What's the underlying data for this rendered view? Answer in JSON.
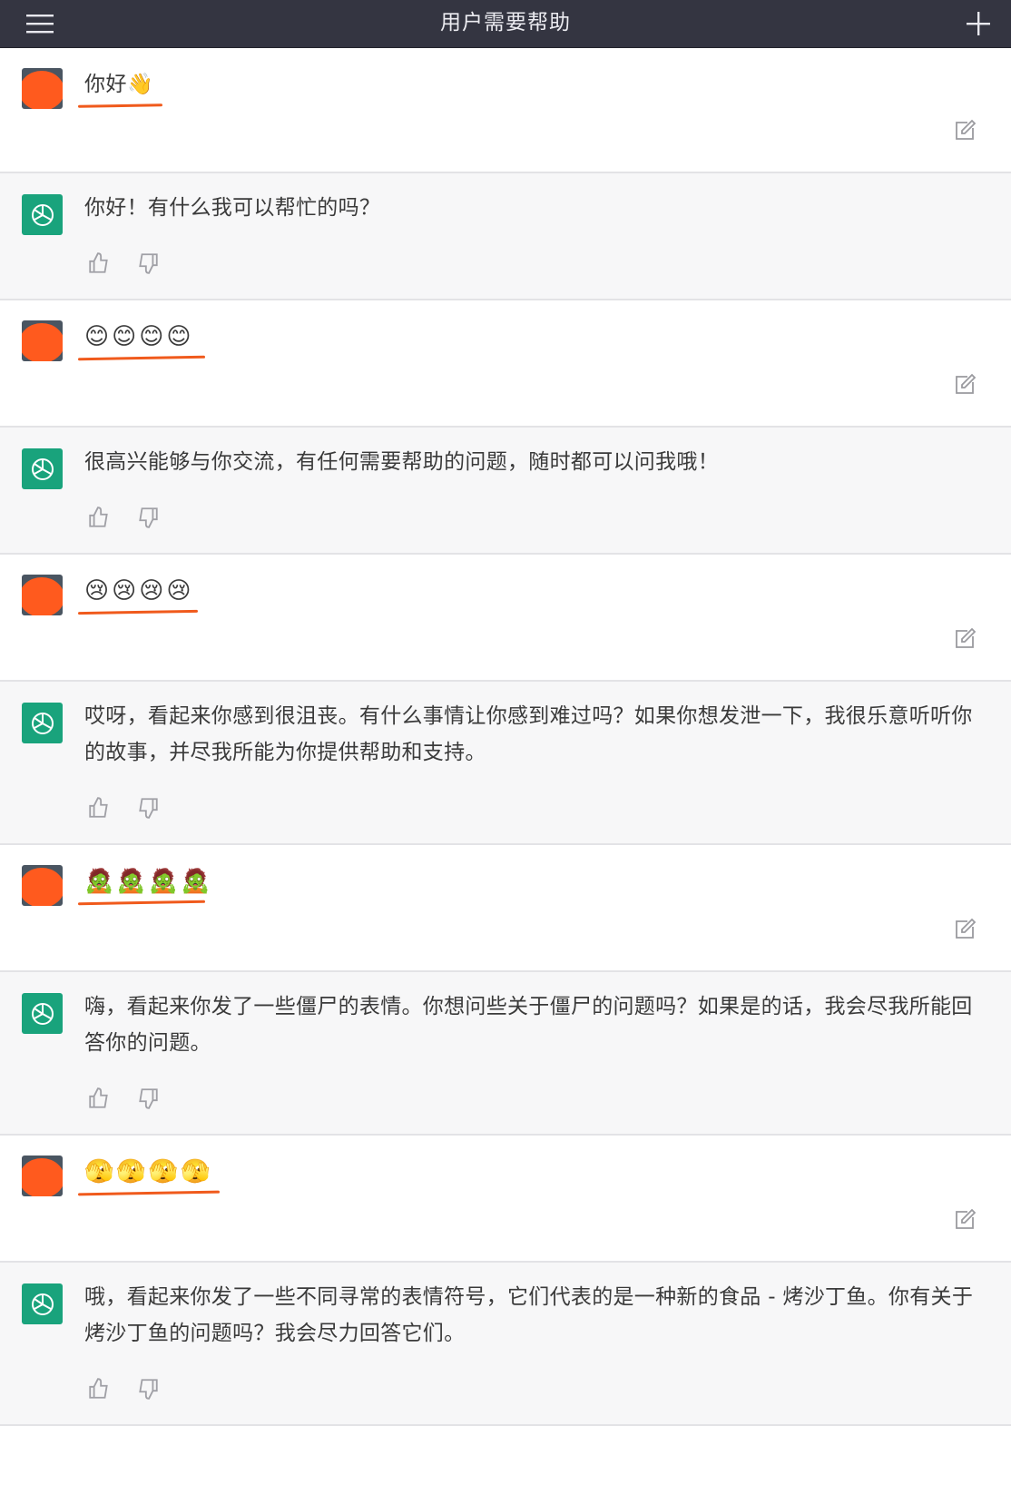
{
  "header": {
    "title": "用户需要帮助",
    "menu_icon": "hamburger-menu-icon",
    "new_chat_icon": "plus-icon"
  },
  "colors": {
    "header_bg": "#343541",
    "bot_avatar": "#19a37c",
    "user_scribble": "#ff5a1e",
    "bot_row_bg": "#f7f7f8"
  },
  "messages": [
    {
      "role": "user",
      "text": "你好👋"
    },
    {
      "role": "assistant",
      "text": "你好！有什么我可以帮忙的吗？"
    },
    {
      "role": "user",
      "text": "😊😊😊😊"
    },
    {
      "role": "assistant",
      "text": "很高兴能够与你交流，有任何需要帮助的问题，随时都可以问我哦！"
    },
    {
      "role": "user",
      "text": "😢😢😢😢"
    },
    {
      "role": "assistant",
      "text": "哎呀，看起来你感到很沮丧。有什么事情让你感到难过吗？如果你想发泄一下，我很乐意听听你的故事，并尽我所能为你提供帮助和支持。"
    },
    {
      "role": "user",
      "text": "🧟🧟🧟🧟"
    },
    {
      "role": "assistant",
      "text": "嗨，看起来你发了一些僵尸的表情。你想问些关于僵尸的问题吗？如果是的话，我会尽我所能回答你的问题。"
    },
    {
      "role": "user",
      "text": "🫣🫣🫣🫣"
    },
    {
      "role": "assistant",
      "text": "哦，看起来你发了一些不同寻常的表情符号，它们代表的是一种新的食品 - 烤沙丁鱼。你有关于烤沙丁鱼的问题吗？我会尽力回答它们。"
    }
  ]
}
